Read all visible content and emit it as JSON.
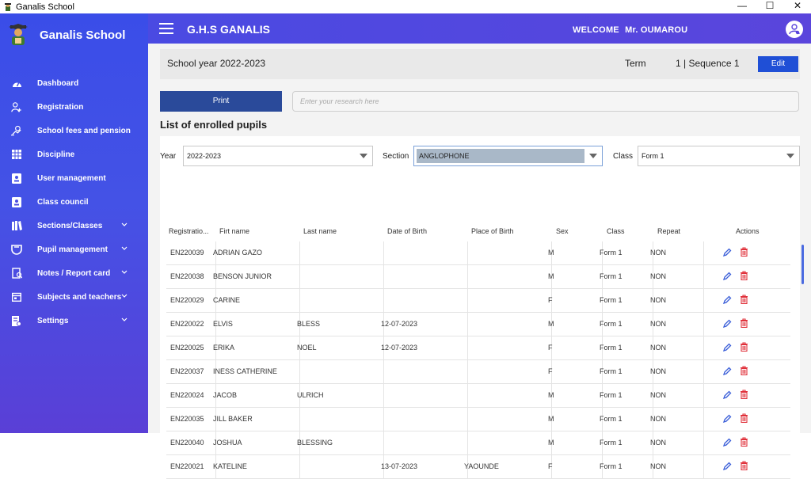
{
  "window": {
    "title": "Ganalis School",
    "minimize": "—",
    "maximize": "☐",
    "close": "✕"
  },
  "sidebar": {
    "brand": "Ganalis School",
    "items": [
      {
        "label": "Dashboard",
        "icon": "dashboard-icon",
        "expandable": false
      },
      {
        "label": "Registration",
        "icon": "add-user-icon",
        "expandable": false
      },
      {
        "label": "School fees and pension",
        "icon": "money-icon",
        "expandable": false
      },
      {
        "label": "Discipline",
        "icon": "grid-icon",
        "expandable": false
      },
      {
        "label": "User management",
        "icon": "badge-icon",
        "expandable": false
      },
      {
        "label": "Class council",
        "icon": "badge-icon",
        "expandable": false
      },
      {
        "label": "Sections/Classes",
        "icon": "classes-icon",
        "expandable": true
      },
      {
        "label": "Pupil management",
        "icon": "graduation-icon",
        "expandable": true
      },
      {
        "label": "Notes / Report card",
        "icon": "report-icon",
        "expandable": true
      },
      {
        "label": "Subjects and teachers",
        "icon": "calendar-icon",
        "expandable": true
      },
      {
        "label": "Settings",
        "icon": "settings-icon",
        "expandable": true
      }
    ]
  },
  "header": {
    "school": "G.H.S GANALIS",
    "welcome": "WELCOME",
    "user": "Mr.  OUMAROU"
  },
  "yearbar": {
    "school_year": "School year 2022-2023",
    "term_label": "Term",
    "term_value": "1 | Sequence   1",
    "edit": "Edit"
  },
  "toolbar": {
    "print": "Print",
    "search_placeholder": "Enter your research here"
  },
  "list_title": "List of enrolled pupils",
  "filters": {
    "year_label": "Year",
    "year_value": "2022-2023",
    "section_label": "Section",
    "section_value": "ANGLOPHONE",
    "class_label": "Class",
    "class_value": "Form 1"
  },
  "table": {
    "columns": [
      "Registratio...",
      "Firt name",
      "Last name",
      "Date of Birth",
      "Place of Birth",
      "Sex",
      "Class",
      "Repeat",
      "Actions"
    ],
    "rows": [
      {
        "reg": "EN220039",
        "first": "ADRIAN GAZO",
        "last": "",
        "dob": "",
        "pob": "",
        "sex": "M",
        "class": "Form 1",
        "repeat": "NON"
      },
      {
        "reg": "EN220038",
        "first": "BENSON JUNIOR",
        "last": "",
        "dob": "",
        "pob": "",
        "sex": "M",
        "class": "Form 1",
        "repeat": "NON"
      },
      {
        "reg": "EN220029",
        "first": "CARINE",
        "last": "",
        "dob": "",
        "pob": "",
        "sex": "F",
        "class": "Form 1",
        "repeat": "NON"
      },
      {
        "reg": "EN220022",
        "first": "ELVIS",
        "last": "BLESS",
        "dob": "12-07-2023",
        "pob": "",
        "sex": "M",
        "class": "Form 1",
        "repeat": "NON"
      },
      {
        "reg": "EN220025",
        "first": "ERIKA",
        "last": "NOEL",
        "dob": "12-07-2023",
        "pob": "",
        "sex": "F",
        "class": "Form 1",
        "repeat": "NON"
      },
      {
        "reg": "EN220037",
        "first": "INESS CATHERINE",
        "last": "",
        "dob": "",
        "pob": "",
        "sex": "F",
        "class": "Form 1",
        "repeat": "NON"
      },
      {
        "reg": "EN220024",
        "first": "JACOB",
        "last": "ULRICH",
        "dob": "",
        "pob": "",
        "sex": "M",
        "class": "Form 1",
        "repeat": "NON"
      },
      {
        "reg": "EN220035",
        "first": "JILL BAKER",
        "last": "",
        "dob": "",
        "pob": "",
        "sex": "M",
        "class": "Form 1",
        "repeat": "NON"
      },
      {
        "reg": "EN220040",
        "first": "JOSHUA",
        "last": "BLESSING",
        "dob": "",
        "pob": "",
        "sex": "M",
        "class": "Form 1",
        "repeat": "NON"
      },
      {
        "reg": "EN220021",
        "first": "KATELINE",
        "last": "",
        "dob": "13-07-2023",
        "pob": "YAOUNDE",
        "sex": "F",
        "class": "Form 1",
        "repeat": "NON"
      }
    ]
  },
  "colors": {
    "sidebar_top": "#3a4de8",
    "sidebar_bottom": "#5a3fd6",
    "header": "#4a4ae2",
    "edit_button": "#1f4fd6",
    "print_button": "#2a4a9a",
    "edit_icon": "#3a5ed8",
    "delete_icon": "#e0303a"
  }
}
